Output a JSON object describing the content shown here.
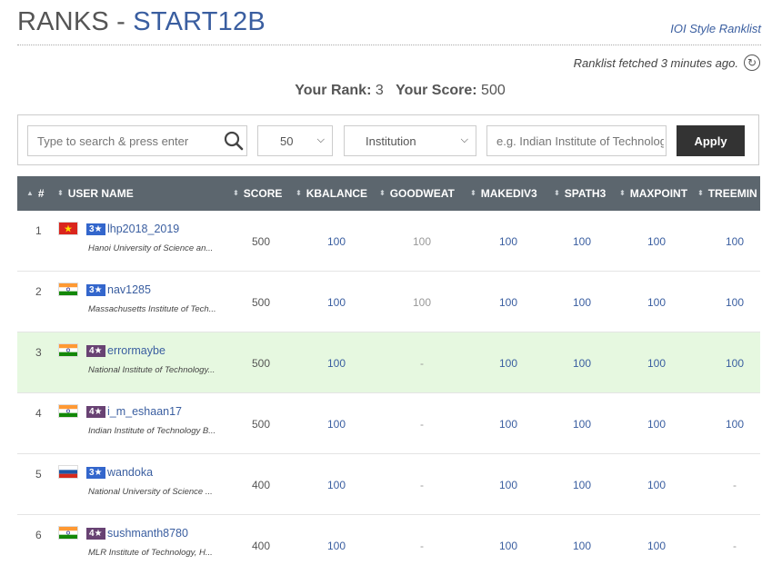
{
  "header": {
    "title_prefix": "RANKS - ",
    "contest": "START12B",
    "style_link": "IOI Style Ranklist",
    "fetched": "Ranklist fetched 3 minutes ago."
  },
  "summary": {
    "rank_label": "Your Rank:",
    "rank_value": "3",
    "score_label": "Your Score:",
    "score_value": "500"
  },
  "filters": {
    "search_placeholder": "Type to search & press enter",
    "page_size": "50",
    "filter_type": "Institution",
    "institution_placeholder": "e.g. Indian Institute of Technology",
    "apply_label": "Apply"
  },
  "columns": [
    "#",
    "USER NAME",
    "SCORE",
    "KBALANCE",
    "GOODWEAT",
    "MAKEDIV3",
    "SPATH3",
    "MAXPOINT",
    "TREEMIN"
  ],
  "rows": [
    {
      "rank": "1",
      "flag": "vn",
      "rating": "3★",
      "rating_color": "#3366cc",
      "user": "lhp2018_2019",
      "inst": "Hanoi University of Science an...",
      "score": "500",
      "kbalance": "100",
      "goodweat": "100",
      "makediv3": "100",
      "spath3": "100",
      "maxpoint": "100",
      "treemin": "100"
    },
    {
      "rank": "2",
      "flag": "in",
      "rating": "3★",
      "rating_color": "#3366cc",
      "user": "nav1285",
      "inst": "Massachusetts Institute of Tech...",
      "score": "500",
      "kbalance": "100",
      "goodweat": "100",
      "makediv3": "100",
      "spath3": "100",
      "maxpoint": "100",
      "treemin": "100"
    },
    {
      "rank": "3",
      "flag": "in",
      "rating": "4★",
      "rating_color": "#684273",
      "user": "errormaybe",
      "inst": "National Institute of Technology...",
      "score": "500",
      "kbalance": "100",
      "goodweat": "-",
      "makediv3": "100",
      "spath3": "100",
      "maxpoint": "100",
      "treemin": "100",
      "highlight": true
    },
    {
      "rank": "4",
      "flag": "in",
      "rating": "4★",
      "rating_color": "#684273",
      "user": "i_m_eshaan17",
      "inst": "Indian Institute of Technology B...",
      "score": "500",
      "kbalance": "100",
      "goodweat": "-",
      "makediv3": "100",
      "spath3": "100",
      "maxpoint": "100",
      "treemin": "100"
    },
    {
      "rank": "5",
      "flag": "ru",
      "rating": "3★",
      "rating_color": "#3366cc",
      "user": "wandoka",
      "inst": "National University of Science ...",
      "score": "400",
      "kbalance": "100",
      "goodweat": "-",
      "makediv3": "100",
      "spath3": "100",
      "maxpoint": "100",
      "treemin": "-"
    },
    {
      "rank": "6",
      "flag": "in",
      "rating": "4★",
      "rating_color": "#684273",
      "user": "sushmanth8780",
      "inst": "MLR Institute of Technology, H...",
      "score": "400",
      "kbalance": "100",
      "goodweat": "-",
      "makediv3": "100",
      "spath3": "100",
      "maxpoint": "100",
      "treemin": "-"
    }
  ],
  "colors": {
    "link": "#3a5ea0",
    "header_bg": "#5c666e",
    "highlight": "#e6f8e0",
    "apply_bg": "#333333"
  }
}
